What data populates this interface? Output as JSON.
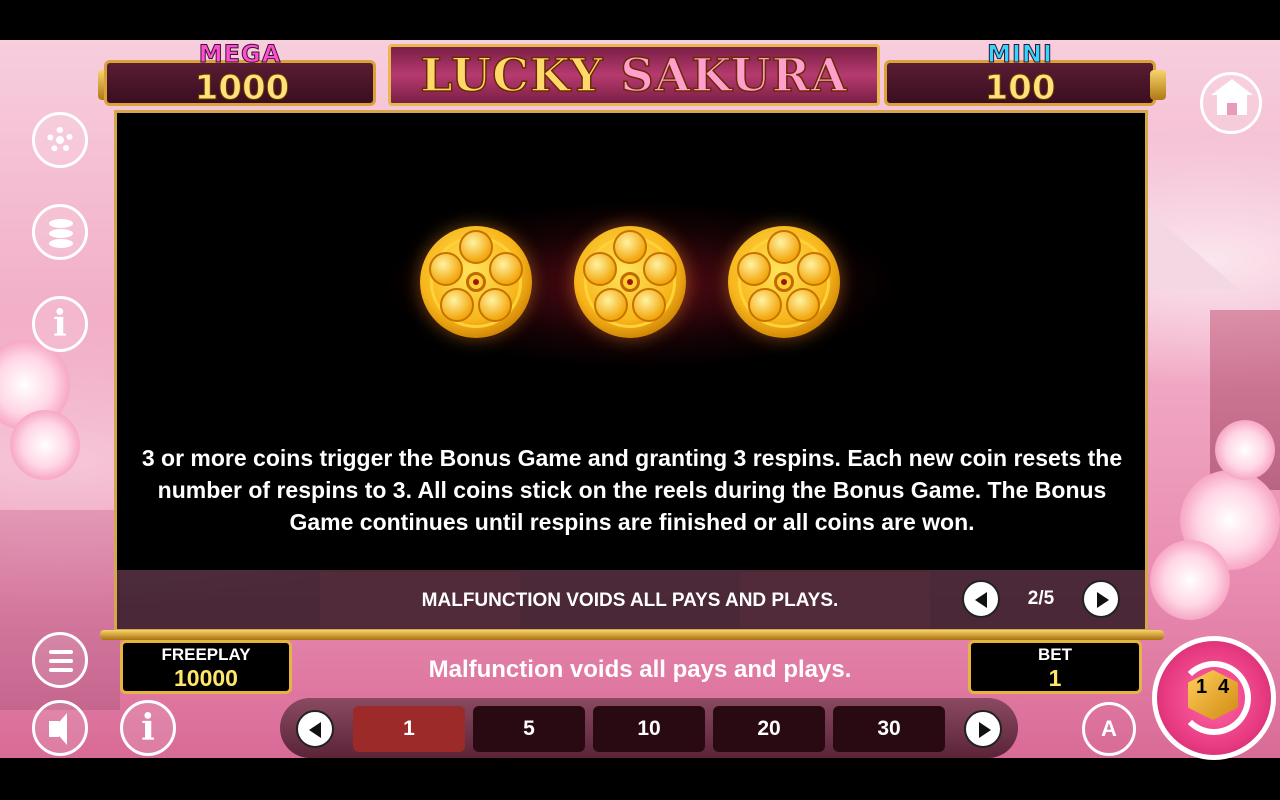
{
  "jackpots": {
    "mega": {
      "label": "MEGA",
      "value": "1000",
      "color": "#ff4fd0"
    },
    "mini": {
      "label": "MINI",
      "value": "100",
      "color": "#33d6ff"
    }
  },
  "logo": {
    "word1": "LUCKY",
    "word2": "SAKURA"
  },
  "rules": {
    "text": "3 or more coins trigger the Bonus Game and granting 3 respins. Each new coin resets the number of respins to 3. All coins stick on the reels during the Bonus Game. The Bonus Game continues until respins are finished or all coins are won.",
    "notice": "MALFUNCTION VOIDS ALL PAYS AND PLAYS.",
    "page": "2/5",
    "coin_count": 3
  },
  "footer": {
    "freeplay_label": "FREEPLAY",
    "freeplay_value": "10000",
    "bet_label": "BET",
    "bet_value": "1",
    "malfunction": "Malfunction voids all pays and plays."
  },
  "bet_options": [
    "1",
    "5",
    "10",
    "20",
    "30"
  ],
  "bet_selected": "1",
  "spin": {
    "digit_left": "1",
    "digit_right": "4"
  },
  "auto_label": "A",
  "info_glyph": "i",
  "icons": [
    "gear-icon",
    "coins-icon",
    "info-icon",
    "menu-icon",
    "sound-icon",
    "home-icon"
  ],
  "colors": {
    "gold": "#d9a23a",
    "panel": "#000000",
    "active_bet": "#9b2a28"
  }
}
